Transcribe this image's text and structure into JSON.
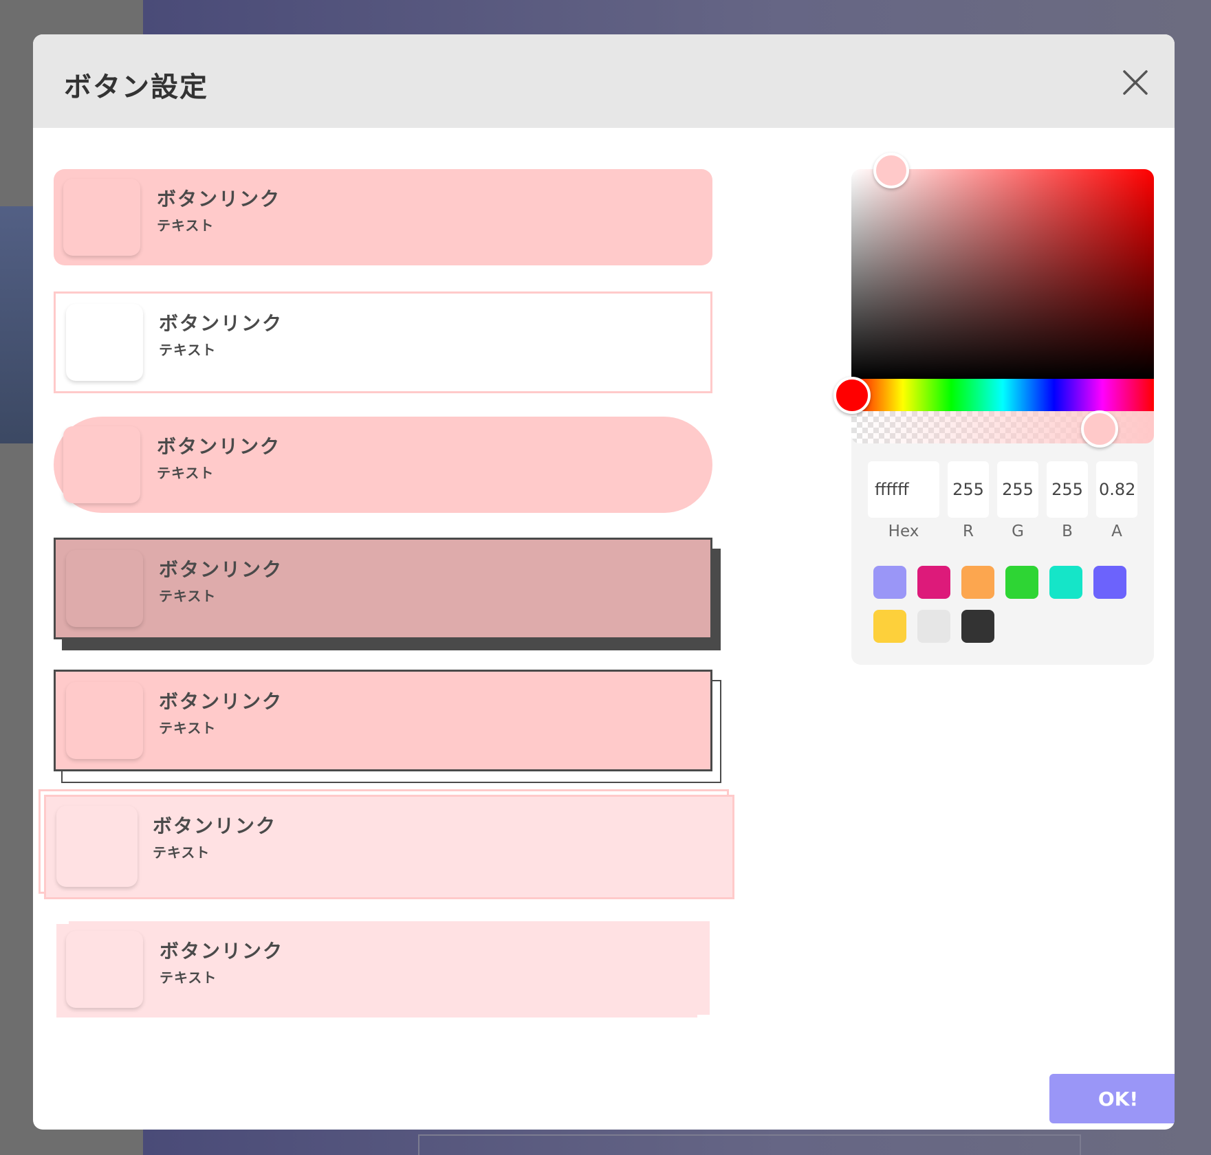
{
  "modal": {
    "title": "ボタン設定",
    "close_icon": "close-icon"
  },
  "samples": [
    {
      "title": "ボタンリンク",
      "subtitle": "テキスト"
    },
    {
      "title": "ボタンリンク",
      "subtitle": "テキスト"
    },
    {
      "title": "ボタンリンク",
      "subtitle": "テキスト"
    },
    {
      "title": "ボタンリンク",
      "subtitle": "テキスト"
    },
    {
      "title": "ボタンリンク",
      "subtitle": "テキスト"
    },
    {
      "title": "ボタンリンク",
      "subtitle": "テキスト"
    },
    {
      "title": "ボタンリンク",
      "subtitle": "テキスト"
    }
  ],
  "colors": {
    "accent_pink": "#ffcaca",
    "light_pink": "#ffe1e3",
    "shadow_pink": "#deabab",
    "dark": "#4a4a4a",
    "ok_button": "#9a96f7"
  },
  "picker": {
    "hex_value": "ffffff",
    "r_value": "255",
    "g_value": "255",
    "b_value": "255",
    "a_value": "0.82",
    "hex_label": "Hex",
    "r_label": "R",
    "g_label": "G",
    "b_label": "B",
    "a_label": "A",
    "swatches": [
      "#9a96f7",
      "#dd1a7a",
      "#fca64f",
      "#2ed534",
      "#15e5c8",
      "#6c63fc",
      "#fdd03b",
      "#e6e6e6",
      "#333333"
    ]
  },
  "ok_label": "OK!"
}
